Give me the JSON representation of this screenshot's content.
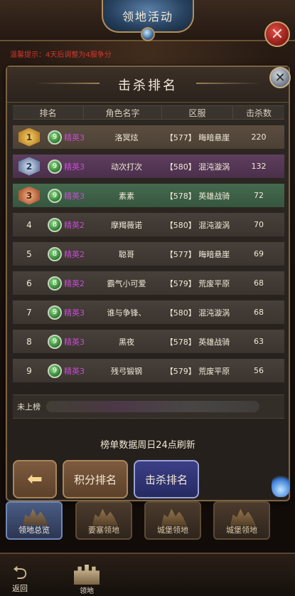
{
  "header": {
    "title": "领地活动",
    "tip": "温馨提示：4天后调整为4服争分"
  },
  "dialog": {
    "title": "击杀排名",
    "columns": [
      "排名",
      "角色名字",
      "区服",
      "击杀数"
    ],
    "rows": [
      {
        "rank": "1",
        "level": "9",
        "tier": "精英3",
        "name": "洛冥炫",
        "server": "【577】 晦暗悬崖",
        "kills": "220"
      },
      {
        "rank": "2",
        "level": "9",
        "tier": "精英3",
        "name": "动次打次",
        "server": "【580】 混沌漩涡",
        "kills": "132"
      },
      {
        "rank": "3",
        "level": "9",
        "tier": "精英3",
        "name": "素素",
        "server": "【578】 英雄战骑",
        "kills": "72"
      },
      {
        "rank": "4",
        "level": "8",
        "tier": "精英2",
        "name": "摩羯薇诺",
        "server": "【580】 混沌漩涡",
        "kills": "70"
      },
      {
        "rank": "5",
        "level": "8",
        "tier": "精英2",
        "name": "聪哥",
        "server": "【577】 晦暗悬崖",
        "kills": "69"
      },
      {
        "rank": "6",
        "level": "8",
        "tier": "精英2",
        "name": "霸气小可爱",
        "server": "【579】 荒废平原",
        "kills": "68"
      },
      {
        "rank": "7",
        "level": "9",
        "tier": "精英3",
        "name": "谁与争锋、",
        "server": "【580】 混沌漩涡",
        "kills": "68"
      },
      {
        "rank": "8",
        "level": "9",
        "tier": "精英3",
        "name": "黑夜",
        "server": "【578】 英雄战骑",
        "kills": "63"
      },
      {
        "rank": "9",
        "level": "9",
        "tier": "精英3",
        "name": "残弓锻钢",
        "server": "【579】 荒废平原",
        "kills": "56"
      }
    ],
    "unranked_label": "未上榜",
    "refresh_note": "榜单数据周日24点刷新",
    "buttons": {
      "back": "⬅",
      "score": "积分排名",
      "kill": "击杀排名"
    }
  },
  "territory_tabs": [
    "领地总览",
    "要塞领地",
    "城堡领地",
    "城堡领地"
  ],
  "bottom_nav": {
    "back": "返回",
    "home": "领地"
  },
  "colors": {
    "tier_text": "#c84dd6",
    "tip_text": "#d2362e",
    "row_gold": "#5b4e40",
    "row_purple": "#5e3f5e",
    "row_green": "#456a4e"
  }
}
